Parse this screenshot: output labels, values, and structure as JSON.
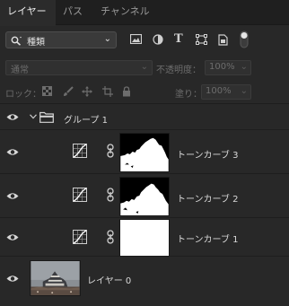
{
  "tabs": [
    {
      "label": "レイヤー",
      "active": true
    },
    {
      "label": "パス",
      "active": false
    },
    {
      "label": "チャンネル",
      "active": false
    }
  ],
  "filter": {
    "kind_label": "種類",
    "icons": [
      "image-filter-icon",
      "adjustment-filter-icon",
      "type-filter-icon",
      "shape-filter-icon",
      "smart-object-filter-icon",
      "filter-toggle-icon"
    ]
  },
  "blend": {
    "mode": "通常",
    "opacity_label": "不透明度：",
    "opacity_value": "100%"
  },
  "lock": {
    "label": "ロック：",
    "fill_label": "塗り：",
    "fill_value": "100%",
    "icons": [
      "lock-transparent-pixels-icon",
      "lock-image-pixels-icon",
      "lock-position-icon",
      "artboard-nesting-icon",
      "lock-all-icon"
    ]
  },
  "layers": [
    {
      "name": "グループ 1",
      "type": "group",
      "expanded": true
    },
    {
      "name": "トーンカーブ 3",
      "type": "adjustment",
      "mask": "silhouette"
    },
    {
      "name": "トーンカーブ 2",
      "type": "adjustment",
      "mask": "silhouette"
    },
    {
      "name": "トーンカーブ 1",
      "type": "adjustment",
      "mask": "white"
    },
    {
      "name": "レイヤー 0",
      "type": "pixel",
      "thumbnail": "castle-photo"
    }
  ],
  "colors": {
    "panel_bg": "#282828",
    "tab_bar_bg": "#1f1f1f",
    "active_tab_bg": "#2b2b2b",
    "text": "#d9d9d9",
    "dim_text": "#6d6d6d"
  }
}
